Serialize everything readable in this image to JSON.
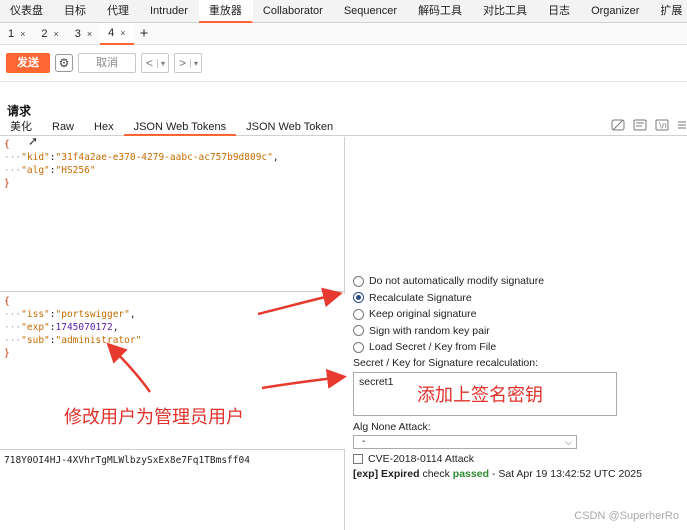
{
  "top_tabs": [
    "仪表盘",
    "目标",
    "代理",
    "Intruder",
    "重放器",
    "Collaborator",
    "Sequencer",
    "解码工具",
    "对比工具",
    "日志",
    "Organizer",
    "扩展"
  ],
  "active_top_tab": "重放器",
  "sub_tabs": [
    {
      "label": "1",
      "close": "×"
    },
    {
      "label": "2",
      "close": "×"
    },
    {
      "label": "3",
      "close": "×"
    },
    {
      "label": "4",
      "close": "×"
    }
  ],
  "add_tab": "+",
  "toolbar": {
    "send": "发送",
    "gear": "⚙",
    "cancel": "取消",
    "back": "<",
    "forward": ">",
    "dropdown": "▾"
  },
  "request_title": "请求",
  "editor_tabs": [
    "美化",
    "Raw",
    "Hex",
    "JSON Web Tokens",
    "JSON Web Token"
  ],
  "active_editor_tab": "JSON Web Tokens",
  "jwt_header": {
    "open": "{",
    "lines": [
      {
        "dots": "···",
        "key": "\"kid\"",
        "sep": ":",
        "value": "\"31f4a2ae-e370-4279-aabc-ac757b9d809c\"",
        "tail": ","
      },
      {
        "dots": "···",
        "key": "\"alg\"",
        "sep": ":",
        "value": "\"HS256\"",
        "tail": ""
      }
    ],
    "close": "}"
  },
  "jwt_payload": {
    "open": "{",
    "lines": [
      {
        "dots": "···",
        "key": "\"iss\"",
        "sep": ":",
        "value": "\"portswigger\"",
        "tail": ","
      },
      {
        "dots": "···",
        "key": "\"exp\"",
        "sep": ":",
        "value": "1745070172",
        "tail": ","
      },
      {
        "dots": "···",
        "key": "\"sub\"",
        "sep": ":",
        "value": "\"administrator\"",
        "tail": ""
      }
    ],
    "close": "}"
  },
  "signature": "718Y0OI4HJ-4XVhrTgMLWlbzySxEx8e7Fq1TBmsff04",
  "signature_options": [
    {
      "label": "Do not automatically modify signature",
      "selected": false
    },
    {
      "label": "Recalculate Signature",
      "selected": true
    },
    {
      "label": "Keep original signature",
      "selected": false
    },
    {
      "label": "Sign with random key pair",
      "selected": false
    },
    {
      "label": "Load Secret / Key from File",
      "selected": false
    }
  ],
  "secret_label": "Secret / Key for Signature recalculation:",
  "secret_value": "secret1",
  "annotation_secret": "添加上签名密钥",
  "annotation_user": "修改用户为管理员用户",
  "alg_none_label": "Alg None Attack:",
  "alg_none_value": "-",
  "cve_label": "CVE-2018-0114 Attack",
  "status": {
    "prefix": "[exp] Expired",
    "mid": " check ",
    "passed": "passed",
    "suffix": " - Sat Apr 19 13:42:52 UTC 2025"
  },
  "watermark": "CSDN @SuperherRo",
  "colors": {
    "accent": "#ff6633",
    "annotation": "#e1302a",
    "passed": "#2e8b2e"
  }
}
